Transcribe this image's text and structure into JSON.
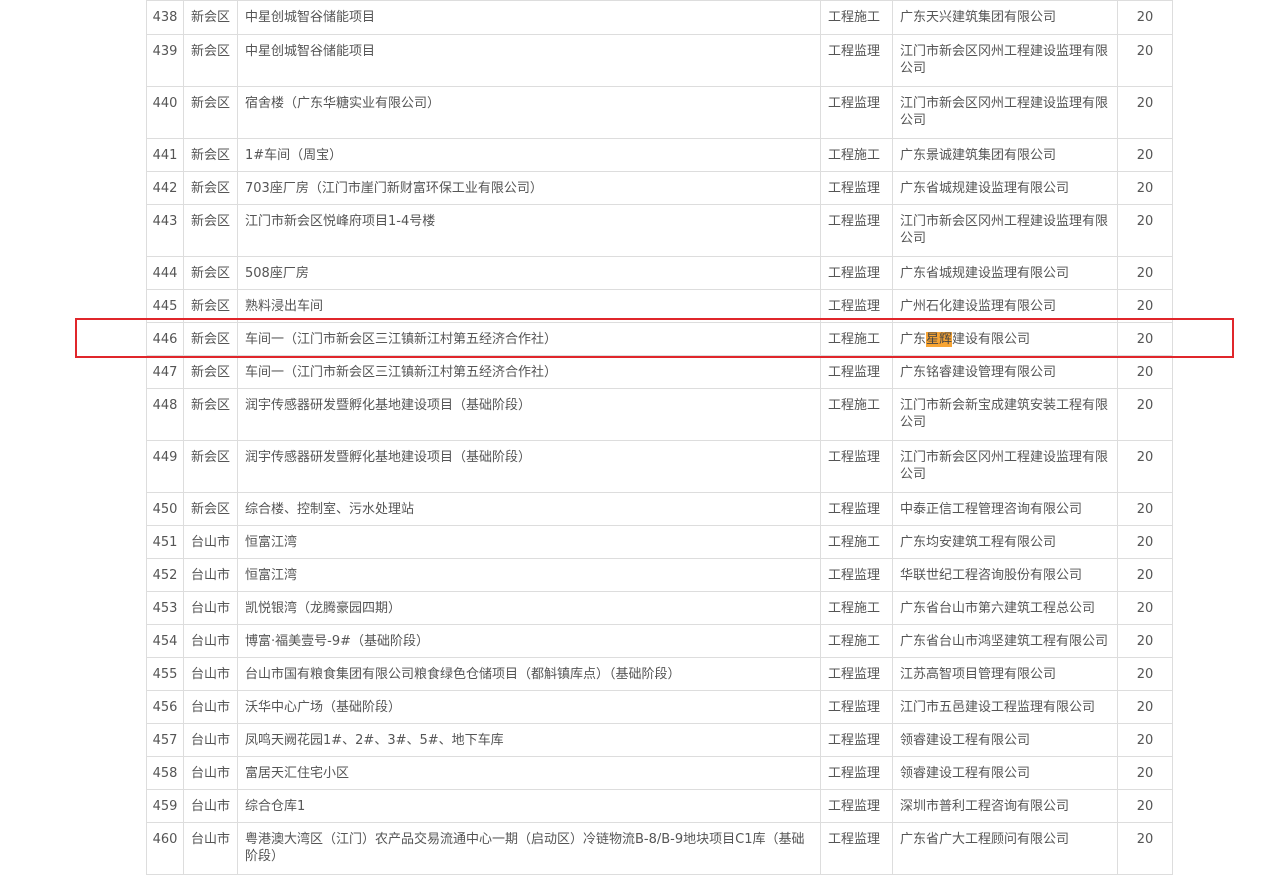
{
  "theme": {
    "border_color": "#dddddd",
    "text_color": "#555555",
    "highlight_color": "#f7a434",
    "box_color": "#e0262b"
  },
  "search_highlight": {
    "term": "星辉",
    "row_no": "446"
  },
  "rows": [
    {
      "no": "438",
      "district": "新会区",
      "project": "中星创城智谷储能项目",
      "type": "工程施工",
      "company": "广东天兴建筑集团有限公司",
      "score": "20"
    },
    {
      "no": "439",
      "district": "新会区",
      "project": "中星创城智谷储能项目",
      "type": "工程监理",
      "company": "江门市新会区冈州工程建设监理有限公司",
      "score": "20"
    },
    {
      "no": "440",
      "district": "新会区",
      "project": "宿舍楼（广东华糖实业有限公司）",
      "type": "工程监理",
      "company": "江门市新会区冈州工程建设监理有限公司",
      "score": "20"
    },
    {
      "no": "441",
      "district": "新会区",
      "project": "1#车间（周宝）",
      "type": "工程施工",
      "company": "广东景诚建筑集团有限公司",
      "score": "20"
    },
    {
      "no": "442",
      "district": "新会区",
      "project": "703座厂房（江门市崖门新财富环保工业有限公司）",
      "type": "工程监理",
      "company": "广东省城规建设监理有限公司",
      "score": "20"
    },
    {
      "no": "443",
      "district": "新会区",
      "project": "江门市新会区悦峰府项目1-4号楼",
      "type": "工程监理",
      "company": "江门市新会区冈州工程建设监理有限公司",
      "score": "20"
    },
    {
      "no": "444",
      "district": "新会区",
      "project": "508座厂房",
      "type": "工程监理",
      "company": "广东省城规建设监理有限公司",
      "score": "20"
    },
    {
      "no": "445",
      "district": "新会区",
      "project": "熟料浸出车间",
      "type": "工程监理",
      "company": "广州石化建设监理有限公司",
      "score": "20"
    },
    {
      "no": "446",
      "district": "新会区",
      "project": "车间一（江门市新会区三江镇新江村第五经济合作社）",
      "type": "工程施工",
      "company_before": "广东",
      "company_highlight": "星辉",
      "company_after": "建设有限公司",
      "score": "20"
    },
    {
      "no": "447",
      "district": "新会区",
      "project": "车间一（江门市新会区三江镇新江村第五经济合作社）",
      "type": "工程监理",
      "company": "广东铭睿建设管理有限公司",
      "score": "20"
    },
    {
      "no": "448",
      "district": "新会区",
      "project": "润宇传感器研发暨孵化基地建设项目（基础阶段）",
      "type": "工程施工",
      "company": "江门市新会新宝成建筑安装工程有限公司",
      "score": "20"
    },
    {
      "no": "449",
      "district": "新会区",
      "project": "润宇传感器研发暨孵化基地建设项目（基础阶段）",
      "type": "工程监理",
      "company": "江门市新会区冈州工程建设监理有限公司",
      "score": "20"
    },
    {
      "no": "450",
      "district": "新会区",
      "project": "综合楼、控制室、污水处理站",
      "type": "工程监理",
      "company": "中泰正信工程管理咨询有限公司",
      "score": "20"
    },
    {
      "no": "451",
      "district": "台山市",
      "project": "恒富江湾",
      "type": "工程施工",
      "company": "广东均安建筑工程有限公司",
      "score": "20"
    },
    {
      "no": "452",
      "district": "台山市",
      "project": "恒富江湾",
      "type": "工程监理",
      "company": "华联世纪工程咨询股份有限公司",
      "score": "20"
    },
    {
      "no": "453",
      "district": "台山市",
      "project": "凯悦银湾（龙腾豪园四期）",
      "type": "工程施工",
      "company": "广东省台山市第六建筑工程总公司",
      "score": "20"
    },
    {
      "no": "454",
      "district": "台山市",
      "project": "博富·福美壹号-9#（基础阶段）",
      "type": "工程施工",
      "company": "广东省台山市鸿坚建筑工程有限公司",
      "score": "20"
    },
    {
      "no": "455",
      "district": "台山市",
      "project": "台山市国有粮食集团有限公司粮食绿色仓储项目（都斛镇库点）（基础阶段）",
      "type": "工程监理",
      "company": "江苏高智项目管理有限公司",
      "score": "20"
    },
    {
      "no": "456",
      "district": "台山市",
      "project": "沃华中心广场（基础阶段）",
      "type": "工程监理",
      "company": "江门市五邑建设工程监理有限公司",
      "score": "20"
    },
    {
      "no": "457",
      "district": "台山市",
      "project": "凤鸣天阙花园1#、2#、3#、5#、地下车库",
      "type": "工程监理",
      "company": "领睿建设工程有限公司",
      "score": "20"
    },
    {
      "no": "458",
      "district": "台山市",
      "project": "富居天汇住宅小区",
      "type": "工程监理",
      "company": "领睿建设工程有限公司",
      "score": "20"
    },
    {
      "no": "459",
      "district": "台山市",
      "project": "综合仓库1",
      "type": "工程监理",
      "company": "深圳市普利工程咨询有限公司",
      "score": "20"
    },
    {
      "no": "460",
      "district": "台山市",
      "project": "粤港澳大湾区（江门）农产品交易流通中心一期（启动区）冷链物流B-8/B-9地块项目C1库（基础阶段）",
      "type": "工程监理",
      "company": "广东省广大工程顾问有限公司",
      "score": "20"
    }
  ]
}
